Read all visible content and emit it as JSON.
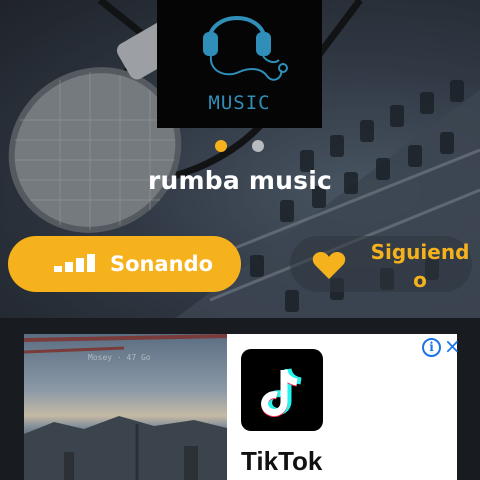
{
  "station": {
    "cover_text": "MUSIC",
    "name": "rumba music"
  },
  "pager": {
    "total": 2,
    "active": 1
  },
  "actions": {
    "playing_label": "Sonando",
    "follow_label": "Siguiendo"
  },
  "ad": {
    "photo_watermark": "Mosey · 47 Go",
    "app_name": "TikTok",
    "info_icon": "i",
    "close_icon": "×"
  },
  "colors": {
    "accent": "#f5b21d",
    "ad_badge": "#1a73e8",
    "cover_art": "#2f8fb8"
  },
  "icons": [
    "headphones-icon",
    "equalizer-bars-icon",
    "heart-icon",
    "tiktok-logo-icon",
    "info-icon",
    "close-icon"
  ]
}
